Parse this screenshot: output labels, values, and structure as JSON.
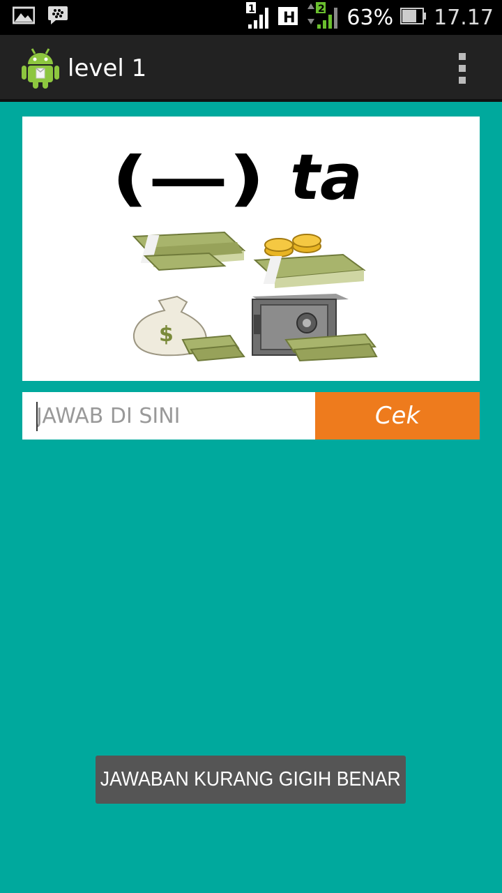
{
  "status_bar": {
    "sim1_label": "1",
    "network_type": "H",
    "sim2_label": "2",
    "battery": "63%",
    "time": "17.17"
  },
  "action_bar": {
    "title": "level 1",
    "app_icon": "android-icon",
    "menu_icon": "overflow-menu-icon"
  },
  "puzzle": {
    "line1_blank": "(—)",
    "line1_suffix": "ta",
    "image_icons": [
      "money-stack-icon",
      "coins-money-icon",
      "money-bag-icon",
      "safe-icon"
    ]
  },
  "answer": {
    "placeholder": "JAWAB DI SINI",
    "value": "",
    "check_label": "Cek"
  },
  "toast": {
    "message": "JAWABAN KURANG GIGIH BENAR"
  },
  "colors": {
    "background": "#00A99D",
    "action_bar": "#222222",
    "check_button": "#EE7B1D",
    "toast": "#555555"
  }
}
